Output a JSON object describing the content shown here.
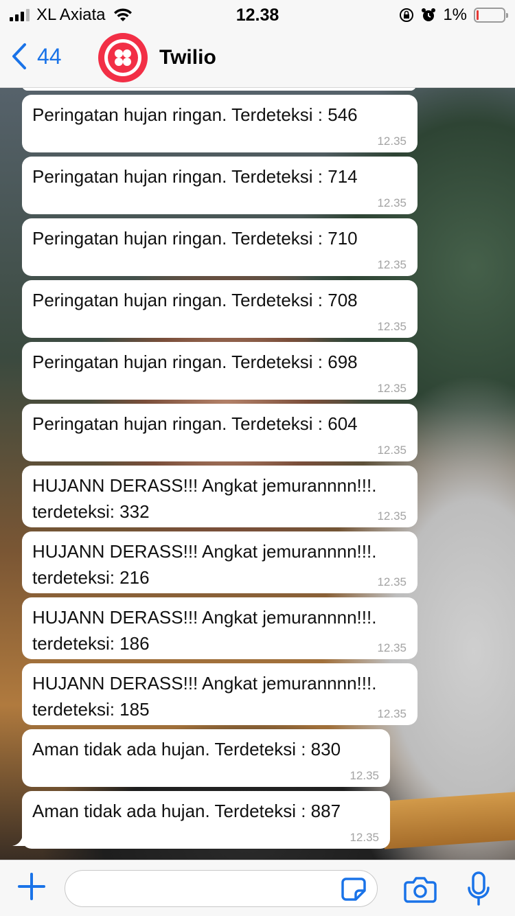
{
  "status_bar": {
    "carrier": "XL Axiata",
    "time": "12.38",
    "battery": "1%",
    "icons": [
      "signal-icon",
      "wifi-icon",
      "orientation-lock-icon",
      "alarm-icon",
      "battery-icon"
    ]
  },
  "header": {
    "back_count": "44",
    "contact_name": "Twilio",
    "avatar_icon": "twilio-logo-icon",
    "accent_color": "#1a73e8",
    "brand_color": "#f22f46"
  },
  "messages": [
    {
      "text": "Peringatan hujan ringan. Terdeteksi : 546",
      "time": "12.35"
    },
    {
      "text": "Peringatan hujan ringan. Terdeteksi : 714",
      "time": "12.35"
    },
    {
      "text": "Peringatan hujan ringan. Terdeteksi : 710",
      "time": "12.35"
    },
    {
      "text": "Peringatan hujan ringan. Terdeteksi : 708",
      "time": "12.35"
    },
    {
      "text": "Peringatan hujan ringan. Terdeteksi : 698",
      "time": "12.35"
    },
    {
      "text": "Peringatan hujan ringan. Terdeteksi : 604",
      "time": "12.35"
    },
    {
      "text": "HUJANN DERASS!!! Angkat jemurannnn!!!. terdeteksi: 332",
      "time": "12.35"
    },
    {
      "text": "HUJANN DERASS!!! Angkat jemurannnn!!!. terdeteksi: 216",
      "time": "12.35"
    },
    {
      "text": "HUJANN DERASS!!! Angkat jemurannnn!!!. terdeteksi: 186",
      "time": "12.35"
    },
    {
      "text": "HUJANN DERASS!!! Angkat jemurannnn!!!. terdeteksi: 185",
      "time": "12.35"
    },
    {
      "text": "Aman tidak ada hujan. Terdeteksi : 830",
      "time": "12.35"
    },
    {
      "text": "Aman tidak ada hujan. Terdeteksi : 887",
      "time": "12.35"
    }
  ],
  "input_bar": {
    "message_value": "",
    "icons": [
      "plus-icon",
      "sticker-icon",
      "camera-icon",
      "microphone-icon"
    ]
  }
}
